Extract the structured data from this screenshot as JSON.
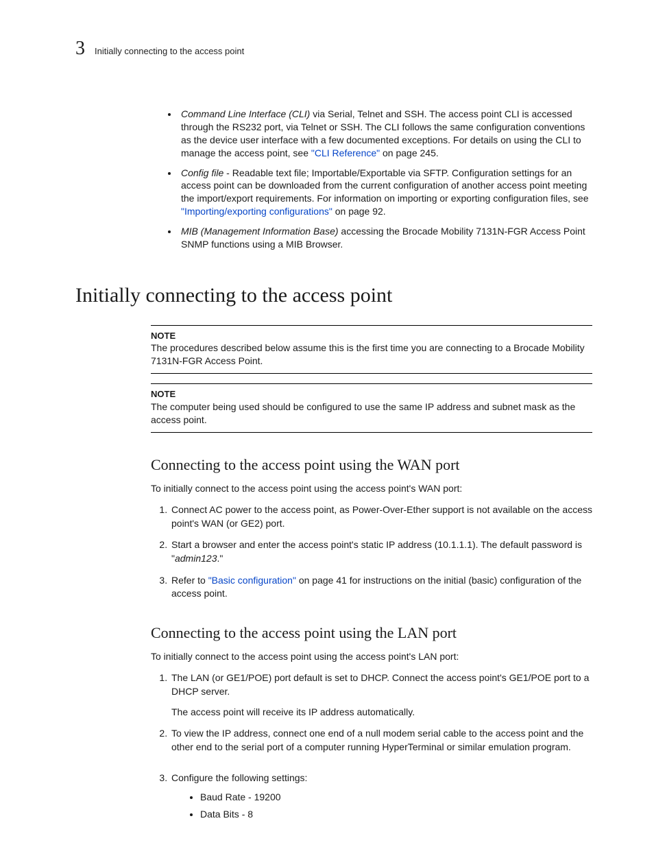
{
  "header": {
    "chapter_number": "3",
    "running_title": "Initially connecting to the access point"
  },
  "bullets": [
    {
      "lead": "Command Line Interface (CLI)",
      "pre": " via Serial, Telnet and SSH. The access point CLI is accessed through the RS232 port, via Telnet or SSH. The CLI follows the same configuration conventions as the device user interface with a few documented exceptions. For details on using the CLI to manage the access point, see ",
      "link": "\"CLI Reference\"",
      "post": " on page 245."
    },
    {
      "lead": "Config file",
      "pre": " - Readable text file; Importable/Exportable via SFTP. Configuration settings for an access point can be downloaded from the current configuration of another access point meeting the import/export requirements. For information on importing or exporting configuration files, see ",
      "link": "\"Importing/exporting configurations\"",
      "post": " on page 92."
    },
    {
      "lead": "MIB (Management Information Base)",
      "pre": " accessing the Brocade Mobility 7131N-FGR Access Point SNMP functions using a MIB Browser.",
      "link": "",
      "post": ""
    }
  ],
  "h1": "Initially connecting to the access point",
  "note1": {
    "label": "NOTE",
    "text": "The procedures described below assume this is the first time you are connecting to a Brocade Mobility 7131N-FGR Access Point."
  },
  "note2": {
    "label": "NOTE",
    "text": "The computer being used should be configured to use the same IP address and subnet mask as the access point."
  },
  "wan": {
    "heading": "Connecting to the access point using the WAN port",
    "intro": "To initially connect to the access point using the access point's WAN port:",
    "steps": {
      "s1": "Connect AC power to the access point, as Power-Over-Ether support is not available on the access point's WAN (or GE2) port.",
      "s2_a": "Start a browser and enter the access point's static IP address (10.1.1.1). The default password is \"",
      "s2_em": "admin123",
      "s2_b": ".\"",
      "s3_a": "Refer to ",
      "s3_link": "\"Basic configuration\"",
      "s3_b": " on page 41 for instructions on the initial (basic) configuration of the access point."
    }
  },
  "lan": {
    "heading": "Connecting to the access point using the LAN port",
    "intro": "To initially connect to the access point using the access point's LAN port:",
    "steps": {
      "s1_a": "The LAN (or GE1/POE) port default is set to DHCP. Connect the access point's GE1/POE port to a DHCP server.",
      "s1_b": "The access point will receive its IP address automatically.",
      "s2": "To view the IP address, connect one end of a null modem serial cable to the access point and the other end to the serial port of a computer running HyperTerminal or similar emulation program.",
      "s3": "Configure the following settings:",
      "settings": {
        "a": "Baud Rate - 19200",
        "b": "Data Bits - 8"
      }
    }
  }
}
